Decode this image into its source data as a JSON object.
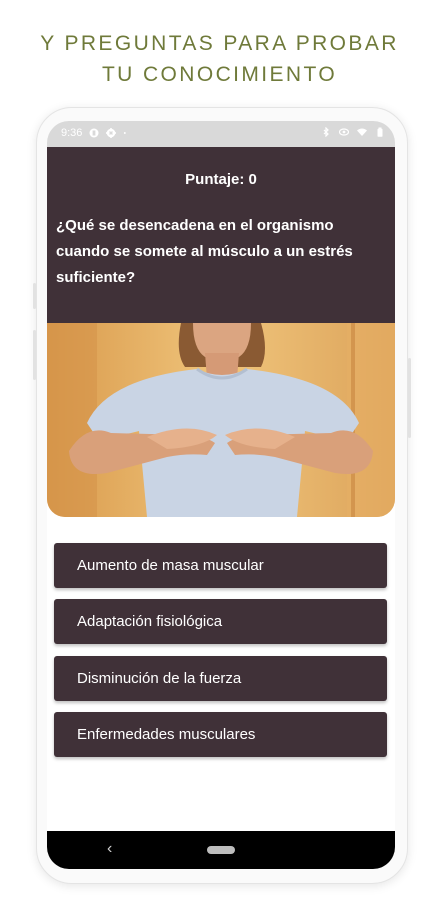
{
  "headline": {
    "line1": "Y PREGUNTAS PARA PROBAR",
    "line2": "TU CONOCIMIENTO"
  },
  "status_bar": {
    "time": "9:36",
    "left_icons": [
      "app-notification-icon",
      "settings-gear-icon",
      "dot-icon"
    ],
    "right_icons": [
      "bluetooth-icon",
      "eye-icon",
      "wifi-icon",
      "battery-icon"
    ]
  },
  "quiz": {
    "score_label": "Puntaje: 0",
    "question": "¿Qué se desencadena en el organismo cuando se somete al músculo a un estrés suficiente?",
    "answers": [
      "Aumento de masa muscular",
      "Adaptación fisiológica",
      "Disminución de la fuerza",
      "Enfermedades musculares"
    ]
  },
  "nav_bar": {
    "back_icon": "chevron-left-icon",
    "home_icon": "home-pill-icon",
    "back_glyph": "‹"
  },
  "colors": {
    "headline": "#6f7a3a",
    "card": "#403138",
    "photo_background": "#e8b466",
    "shirt": "#c7d3e3"
  }
}
